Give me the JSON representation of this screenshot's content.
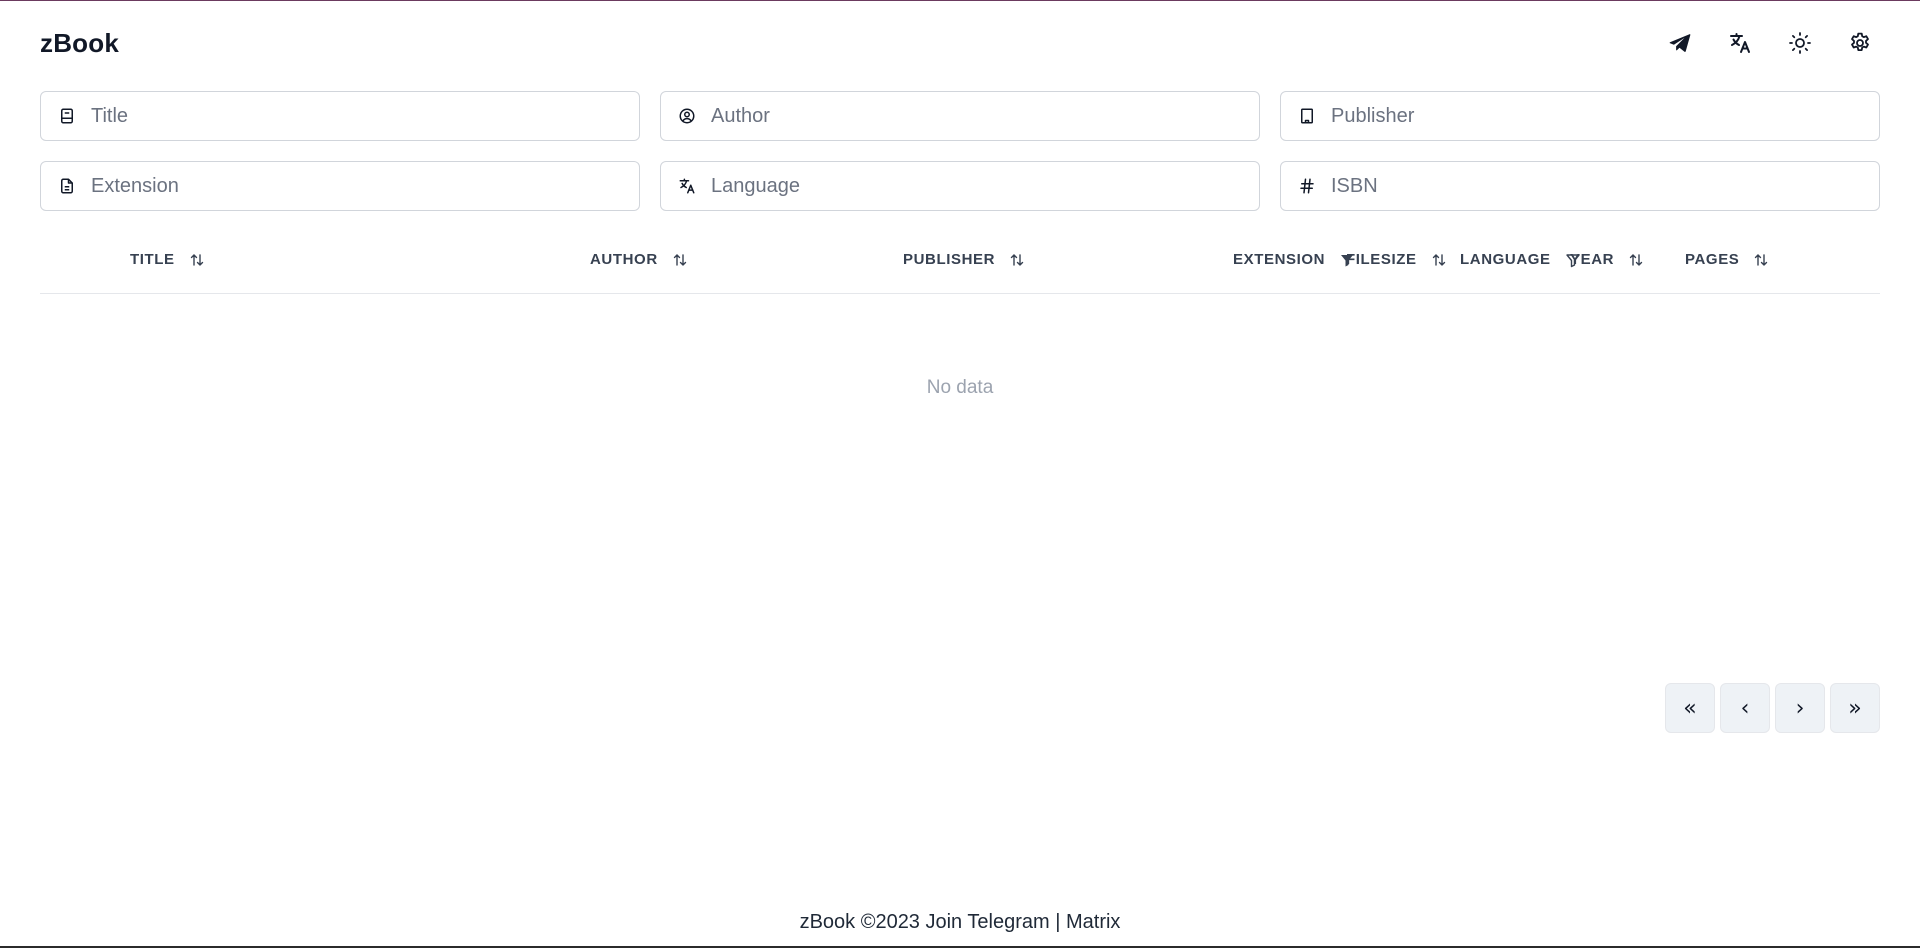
{
  "app": {
    "title": "zBook"
  },
  "header": {
    "actions": [
      {
        "name": "telegram",
        "icon": "telegram-icon"
      },
      {
        "name": "language",
        "icon": "translate-icon"
      },
      {
        "name": "theme",
        "icon": "sun-icon"
      },
      {
        "name": "settings",
        "icon": "gear-icon"
      }
    ]
  },
  "filters": {
    "title": {
      "placeholder": "Title",
      "value": ""
    },
    "author": {
      "placeholder": "Author",
      "value": ""
    },
    "publisher": {
      "placeholder": "Publisher",
      "value": ""
    },
    "extension": {
      "placeholder": "Extension",
      "value": ""
    },
    "language": {
      "placeholder": "Language",
      "value": ""
    },
    "isbn": {
      "placeholder": "ISBN",
      "value": ""
    }
  },
  "table": {
    "columns": [
      "Title",
      "Author",
      "Publisher",
      "Extension",
      "Filesize",
      "Language",
      "Year",
      "Pages"
    ],
    "empty_text": "No data"
  },
  "pagination": {
    "first": "«",
    "prev": "‹",
    "next": "›",
    "last": "»"
  },
  "footer": {
    "text": "zBook ©2023 Join",
    "telegram": "Telegram",
    "separator": "|",
    "matrix": "Matrix"
  }
}
